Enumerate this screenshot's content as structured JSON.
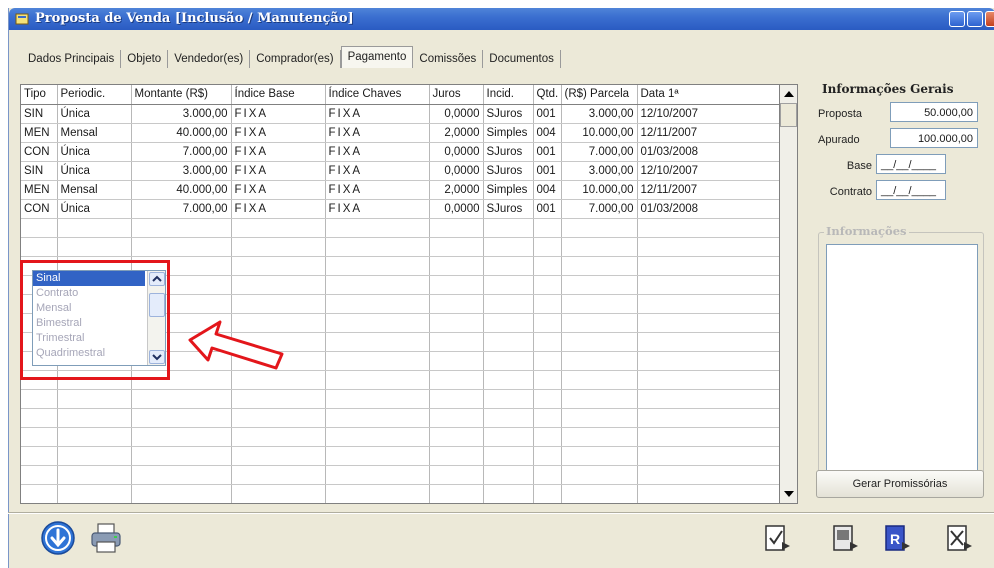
{
  "window": {
    "title": "Proposta de Venda [Inclusão / Manutenção]"
  },
  "tabs": [
    {
      "label": "Dados Principais"
    },
    {
      "label": "Objeto"
    },
    {
      "label": "Vendedor(es)"
    },
    {
      "label": "Comprador(es)"
    },
    {
      "label": "Pagamento",
      "active": true
    },
    {
      "label": "Comissões"
    },
    {
      "label": "Documentos"
    }
  ],
  "grid": {
    "headers": [
      "Tipo",
      "Periodic.",
      "Montante (R$)",
      "Índice Base",
      "Índice Chaves",
      "Juros",
      "Incid.",
      "Qtd.",
      "(R$) Parcela",
      "Data 1ª"
    ],
    "rows": [
      [
        "SIN",
        "Única",
        "3.000,00",
        "FIXA",
        "FIXA",
        "0,0000",
        "SJuros",
        "001",
        "3.000,00",
        "12/10/2007"
      ],
      [
        "MEN",
        "Mensal",
        "40.000,00",
        "FIXA",
        "FIXA",
        "2,0000",
        "Simples",
        "004",
        "10.000,00",
        "12/11/2007"
      ],
      [
        "CON",
        "Única",
        "7.000,00",
        "FIXA",
        "FIXA",
        "0,0000",
        "SJuros",
        "001",
        "7.000,00",
        "01/03/2008"
      ],
      [
        "SIN",
        "Única",
        "3.000,00",
        "FIXA",
        "FIXA",
        "0,0000",
        "SJuros",
        "001",
        "3.000,00",
        "12/10/2007"
      ],
      [
        "MEN",
        "Mensal",
        "40.000,00",
        "FIXA",
        "FIXA",
        "2,0000",
        "Simples",
        "004",
        "10.000,00",
        "12/11/2007"
      ],
      [
        "CON",
        "Única",
        "7.000,00",
        "FIXA",
        "FIXA",
        "0,0000",
        "SJuros",
        "001",
        "7.000,00",
        "01/03/2008"
      ]
    ],
    "empty_rows": 15
  },
  "dropdown": {
    "items": [
      "Sinal",
      "Contrato",
      "Mensal",
      "Bimestral",
      "Trimestral",
      "Quadrimestral"
    ],
    "selected": "Sinal"
  },
  "info": {
    "title": "Informações Gerais",
    "proposta_label": "Proposta",
    "proposta_value": "50.000,00",
    "apurado_label": "Apurado",
    "apurado_value": "100.000,00",
    "base_label": "Base",
    "base_value": "__/__/____",
    "contrato_label": "Contrato",
    "contrato_value": "__/__/____",
    "group_title": "Informações",
    "button_label": "Gerar Promissórias"
  },
  "colors": {
    "accent": "#3163c5",
    "annotation": "#e3161b"
  },
  "toolbar": {
    "left_icons": [
      "down-arrow-circle-icon",
      "printer-icon"
    ],
    "right_icons": [
      "check-document-icon",
      "edit-document-icon",
      "report-document-icon",
      "cancel-document-icon"
    ]
  }
}
